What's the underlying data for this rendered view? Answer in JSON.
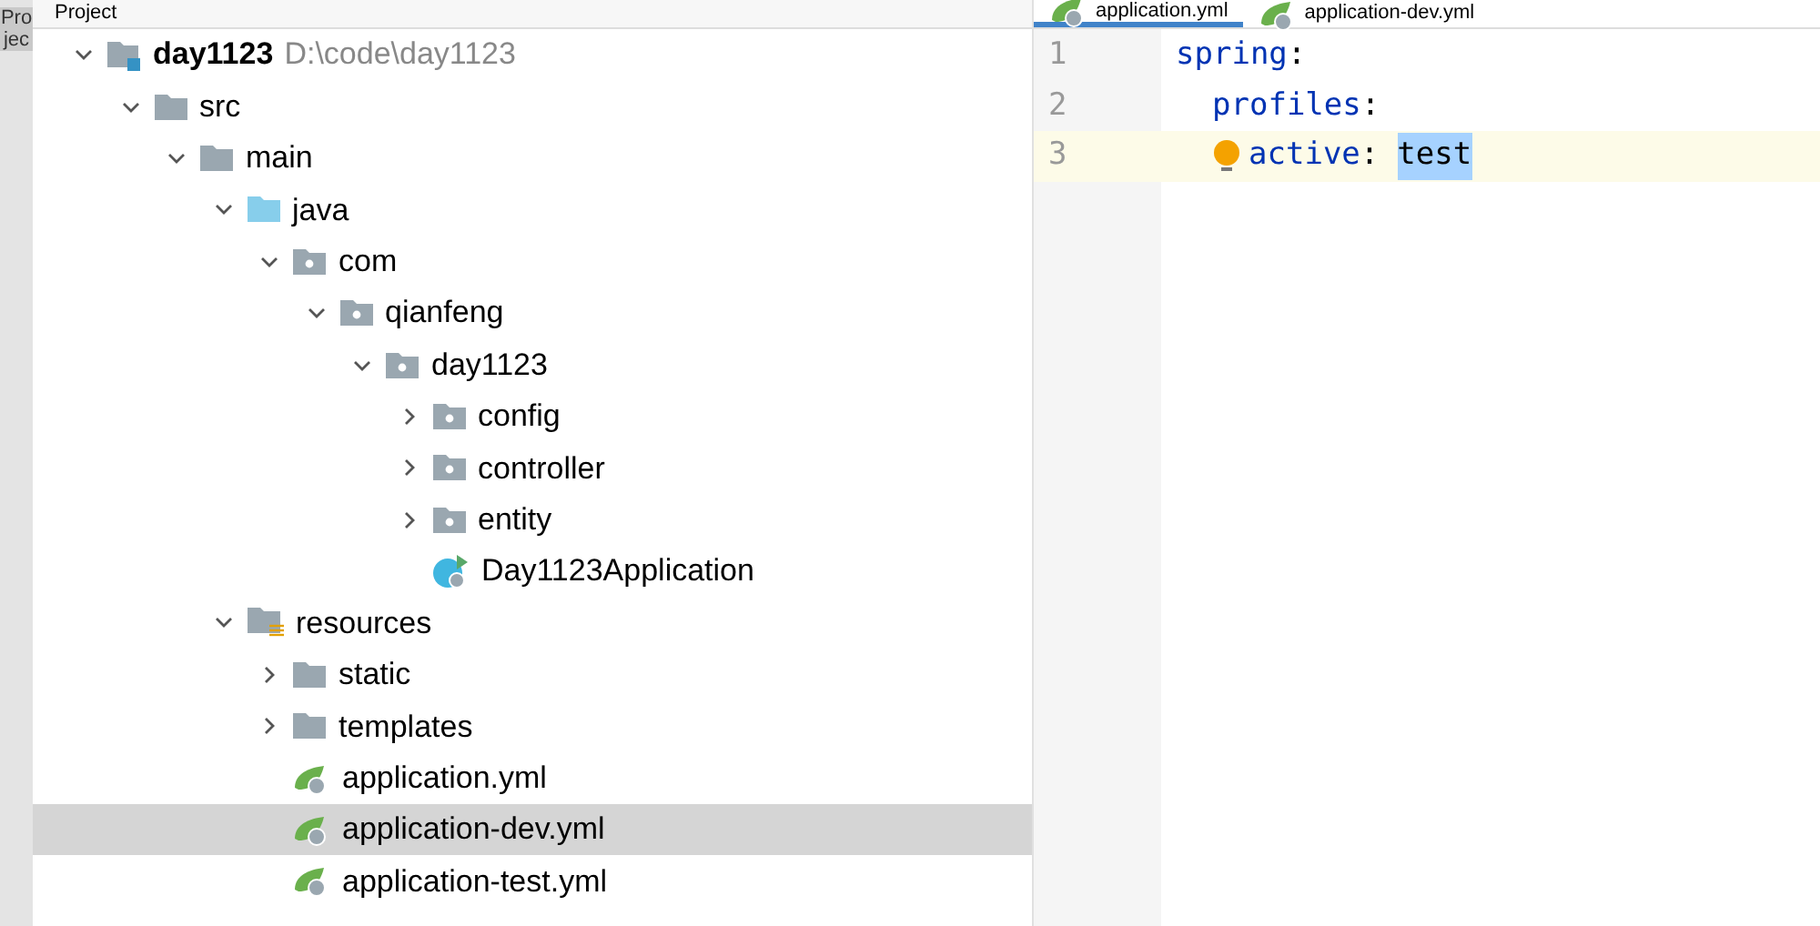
{
  "side_strip": {
    "label": "Projec"
  },
  "project_panel": {
    "title": "Project"
  },
  "tree": [
    {
      "name": "day1123",
      "path": "D:\\code\\day1123",
      "kind": "module",
      "expanded": true,
      "selected": false,
      "children": [
        {
          "name": "src",
          "kind": "folder",
          "expanded": true,
          "selected": false,
          "children": [
            {
              "name": "main",
              "kind": "folder",
              "expanded": true,
              "selected": false,
              "children": [
                {
                  "name": "java",
                  "kind": "source",
                  "expanded": true,
                  "selected": false,
                  "children": [
                    {
                      "name": "com",
                      "kind": "package",
                      "expanded": true,
                      "selected": false,
                      "children": [
                        {
                          "name": "qianfeng",
                          "kind": "package",
                          "expanded": true,
                          "selected": false,
                          "children": [
                            {
                              "name": "day1123",
                              "kind": "package",
                              "expanded": true,
                              "selected": false,
                              "children": [
                                {
                                  "name": "config",
                                  "kind": "package",
                                  "expanded": false,
                                  "selected": false
                                },
                                {
                                  "name": "controller",
                                  "kind": "package",
                                  "expanded": false,
                                  "selected": false
                                },
                                {
                                  "name": "entity",
                                  "kind": "package",
                                  "expanded": false,
                                  "selected": false
                                },
                                {
                                  "name": "Day1123Application",
                                  "kind": "spring_class",
                                  "selected": false
                                }
                              ]
                            }
                          ]
                        }
                      ]
                    }
                  ]
                },
                {
                  "name": "resources",
                  "kind": "resources",
                  "expanded": true,
                  "selected": false,
                  "children": [
                    {
                      "name": "static",
                      "kind": "folder",
                      "expanded": false,
                      "selected": false
                    },
                    {
                      "name": "templates",
                      "kind": "folder",
                      "expanded": false,
                      "selected": false
                    },
                    {
                      "name": "application.yml",
                      "kind": "yml",
                      "selected": false
                    },
                    {
                      "name": "application-dev.yml",
                      "kind": "yml",
                      "selected": true
                    },
                    {
                      "name": "application-test.yml",
                      "kind": "yml",
                      "selected": false
                    }
                  ]
                }
              ]
            }
          ]
        }
      ]
    }
  ],
  "editor_tabs": [
    {
      "label": "application.yml",
      "selected": true
    },
    {
      "label": "application-dev.yml",
      "selected": false
    }
  ],
  "editor_lines": [
    {
      "number": "1",
      "key": "spring",
      "colon": ":",
      "current": false,
      "children": [
        {
          "number": "2",
          "key": "profiles",
          "colon": ":",
          "current": false,
          "children": [
            {
              "number": "3",
              "key": "active",
              "colon": ":",
              "value": "test",
              "value_highlighted": true,
              "current": true,
              "bulb": true
            }
          ]
        }
      ]
    }
  ]
}
